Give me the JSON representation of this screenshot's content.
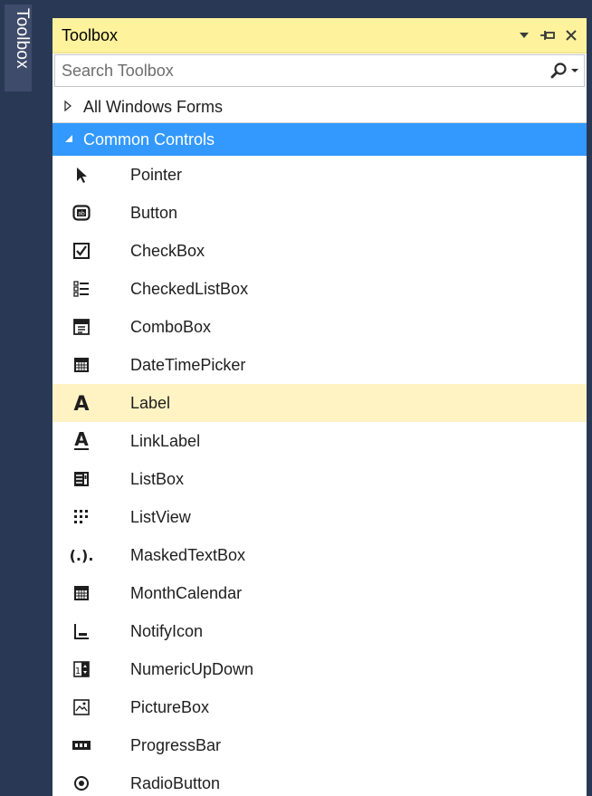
{
  "side_tab": {
    "label": "Toolbox"
  },
  "panel": {
    "title": "Toolbox",
    "controls": {
      "dropdown": "▼",
      "pin": "⊣",
      "close": "✕"
    }
  },
  "search": {
    "placeholder": "Search Toolbox",
    "value": ""
  },
  "groups": [
    {
      "label": "All Windows Forms",
      "state": "collapsed"
    },
    {
      "label": "Common Controls",
      "state": "expanded"
    }
  ],
  "items": [
    {
      "label": "Pointer",
      "icon": "pointer-icon"
    },
    {
      "label": "Button",
      "icon": "button-icon"
    },
    {
      "label": "CheckBox",
      "icon": "checkbox-icon"
    },
    {
      "label": "CheckedListBox",
      "icon": "checkedlistbox-icon"
    },
    {
      "label": "ComboBox",
      "icon": "combobox-icon"
    },
    {
      "label": "DateTimePicker",
      "icon": "datetimepicker-icon"
    },
    {
      "label": "Label",
      "icon": "label-icon",
      "selected": true
    },
    {
      "label": "LinkLabel",
      "icon": "linklabel-icon"
    },
    {
      "label": "ListBox",
      "icon": "listbox-icon"
    },
    {
      "label": "ListView",
      "icon": "listview-icon"
    },
    {
      "label": "MaskedTextBox",
      "icon": "maskedtextbox-icon",
      "glyph": "(.)."
    },
    {
      "label": "MonthCalendar",
      "icon": "monthcalendar-icon"
    },
    {
      "label": "NotifyIcon",
      "icon": "notifyicon-icon"
    },
    {
      "label": "NumericUpDown",
      "icon": "numericupdown-icon"
    },
    {
      "label": "PictureBox",
      "icon": "picturebox-icon"
    },
    {
      "label": "ProgressBar",
      "icon": "progressbar-icon"
    },
    {
      "label": "RadioButton",
      "icon": "radiobutton-icon"
    }
  ],
  "colors": {
    "chrome": "#293955",
    "title_bar": "#fff29d",
    "expanded_group": "#3399ff",
    "selected_item": "#fff3c3"
  }
}
